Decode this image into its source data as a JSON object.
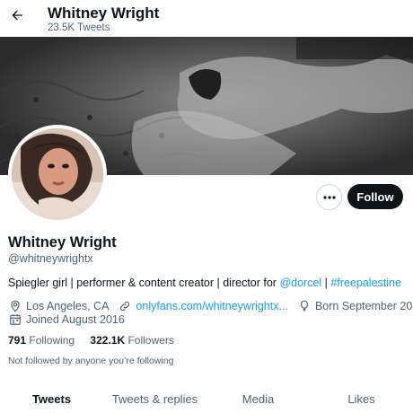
{
  "header": {
    "name": "Whitney Wright",
    "tweet_count": "23.5K Tweets"
  },
  "actions": {
    "follow_label": "Follow"
  },
  "profile": {
    "name": "Whitney Wright",
    "handle": "@whitneywrightx",
    "bio_text": "Spiegler girl | performer & content creator | director for ",
    "bio_mention": "@dorcel",
    "bio_separator": " | ",
    "bio_hashtag": "#freepalestine",
    "location": "Los Angeles, CA",
    "website": "onlyfans.com/whitneywrightx...",
    "birthday": "Born September 20",
    "joined": "Joined August 2016"
  },
  "stats": {
    "following_count": "791",
    "following_label": "Following",
    "followers_count": "322.1K",
    "followers_label": "Followers"
  },
  "not_followed_text": "Not followed by anyone you’re following",
  "tabs": [
    {
      "label": "Tweets",
      "active": true
    },
    {
      "label": "Tweets & replies",
      "active": false
    },
    {
      "label": "Media",
      "active": false
    },
    {
      "label": "Likes",
      "active": false
    }
  ],
  "colors": {
    "accent": "#1d9bf0",
    "text": "#0f1419",
    "secondary": "#536471",
    "button_dark": "#0f1419"
  }
}
